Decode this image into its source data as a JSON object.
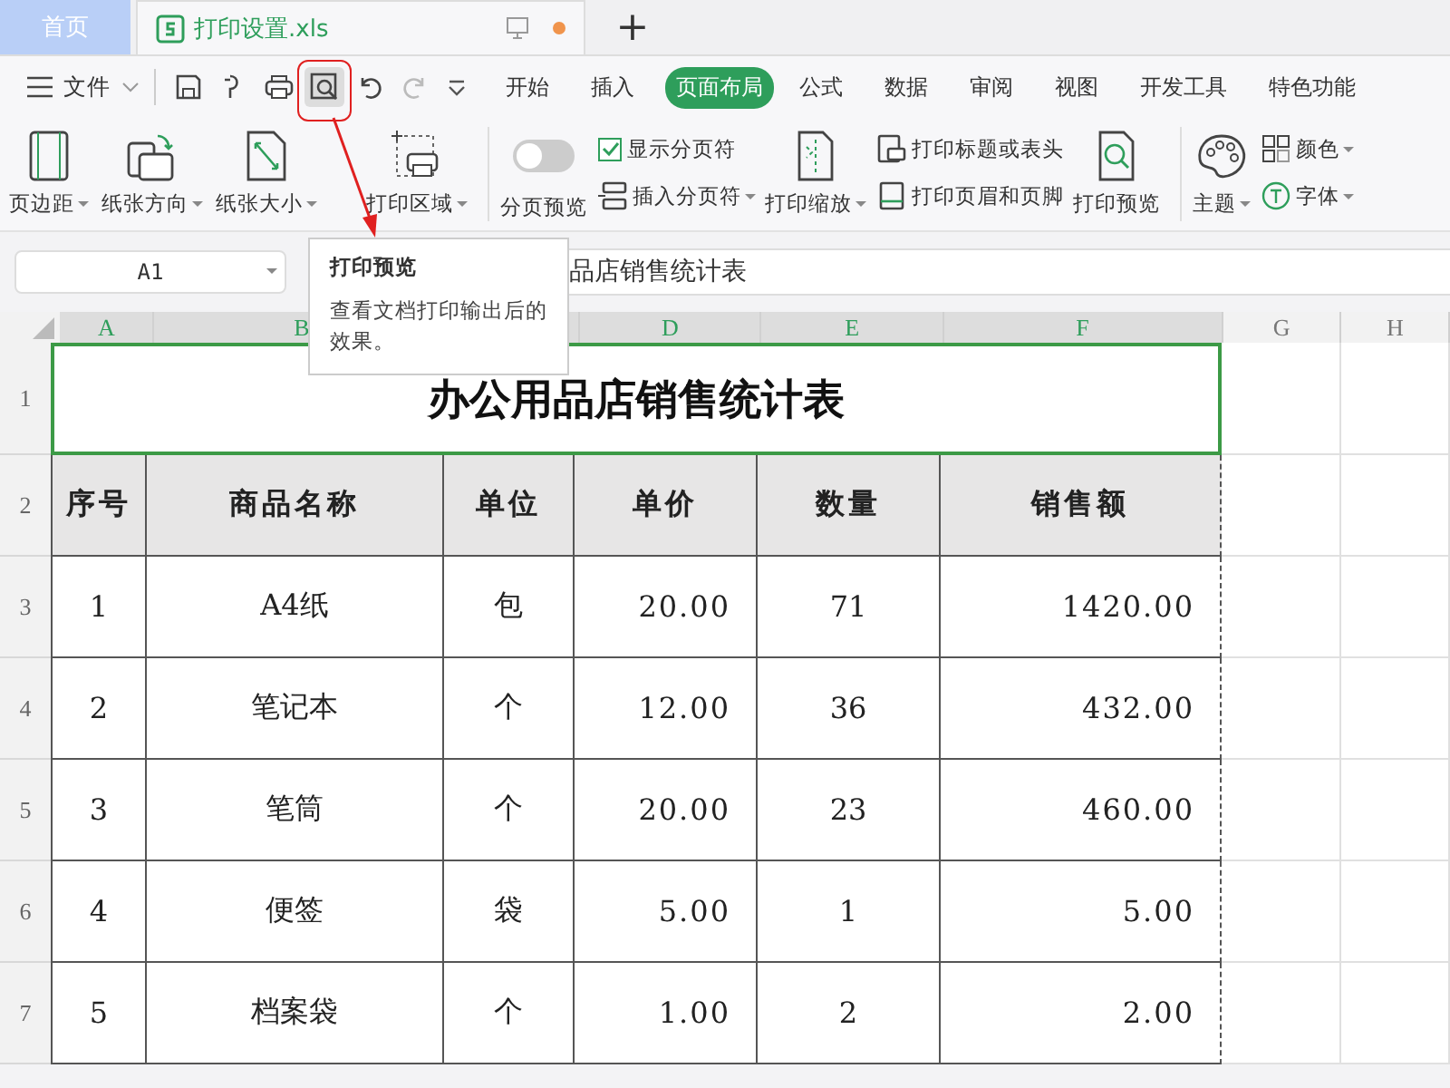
{
  "tabs": [
    {
      "label": "首页",
      "kind": "home",
      "selected": false
    },
    {
      "label": "打印设置.xls",
      "kind": "document",
      "selected": true,
      "modified": true
    }
  ],
  "new_tab": "+",
  "file_menu": "文件",
  "ribbon_tabs": [
    {
      "label": "开始",
      "selected": false
    },
    {
      "label": "插入",
      "selected": false
    },
    {
      "label": "页面布局",
      "selected": true
    },
    {
      "label": "公式",
      "selected": false
    },
    {
      "label": "数据",
      "selected": false
    },
    {
      "label": "审阅",
      "selected": false
    },
    {
      "label": "视图",
      "selected": false
    },
    {
      "label": "开发工具",
      "selected": false
    },
    {
      "label": "特色功能",
      "selected": false
    }
  ],
  "ribbon": {
    "margins": "页边距",
    "orientation": "纸张方向",
    "size": "纸张大小",
    "print_area": "打印区域",
    "page_break_preview": {
      "label": "分页预览",
      "on": false
    },
    "show_page_breaks": {
      "label": "显示分页符",
      "checked": true
    },
    "insert_page_break": "插入分页符",
    "print_scaling": "打印缩放",
    "print_titles": "打印标题或表头",
    "print_header_footer": "打印页眉和页脚",
    "print_preview": "打印预览",
    "theme": "主题",
    "colors": "颜色",
    "fonts": "字体"
  },
  "tooltip": {
    "title": "打印预览",
    "text": "查看文档打印输出后的效果。"
  },
  "name_box": "A1",
  "formula": "品店销售统计表",
  "columns": [
    {
      "label": "A",
      "selected": true
    },
    {
      "label": "B",
      "selected": true
    },
    {
      "selected": true
    },
    {
      "label": "D",
      "selected": true
    },
    {
      "label": "E",
      "selected": true
    },
    {
      "label": "F",
      "selected": true
    },
    {
      "label": "G",
      "selected": false
    },
    {
      "label": "H",
      "selected": false
    }
  ],
  "sheet": {
    "title": "办公用品店销售统计表",
    "headers": [
      "序号",
      "商品名称",
      "单位",
      "单价",
      "数量",
      "销售额"
    ],
    "rows": [
      [
        "1",
        "A4纸",
        "包",
        "20.00",
        "71",
        "1420.00"
      ],
      [
        "2",
        "笔记本",
        "个",
        "12.00",
        "36",
        "432.00"
      ],
      [
        "3",
        "笔筒",
        "个",
        "20.00",
        "23",
        "460.00"
      ],
      [
        "4",
        "便签",
        "袋",
        "5.00",
        "1",
        "5.00"
      ],
      [
        "5",
        "档案袋",
        "个",
        "1.00",
        "2",
        "2.00"
      ]
    ]
  },
  "row_numbers": [
    "1",
    "2",
    "3",
    "4",
    "5",
    "6",
    "7"
  ]
}
